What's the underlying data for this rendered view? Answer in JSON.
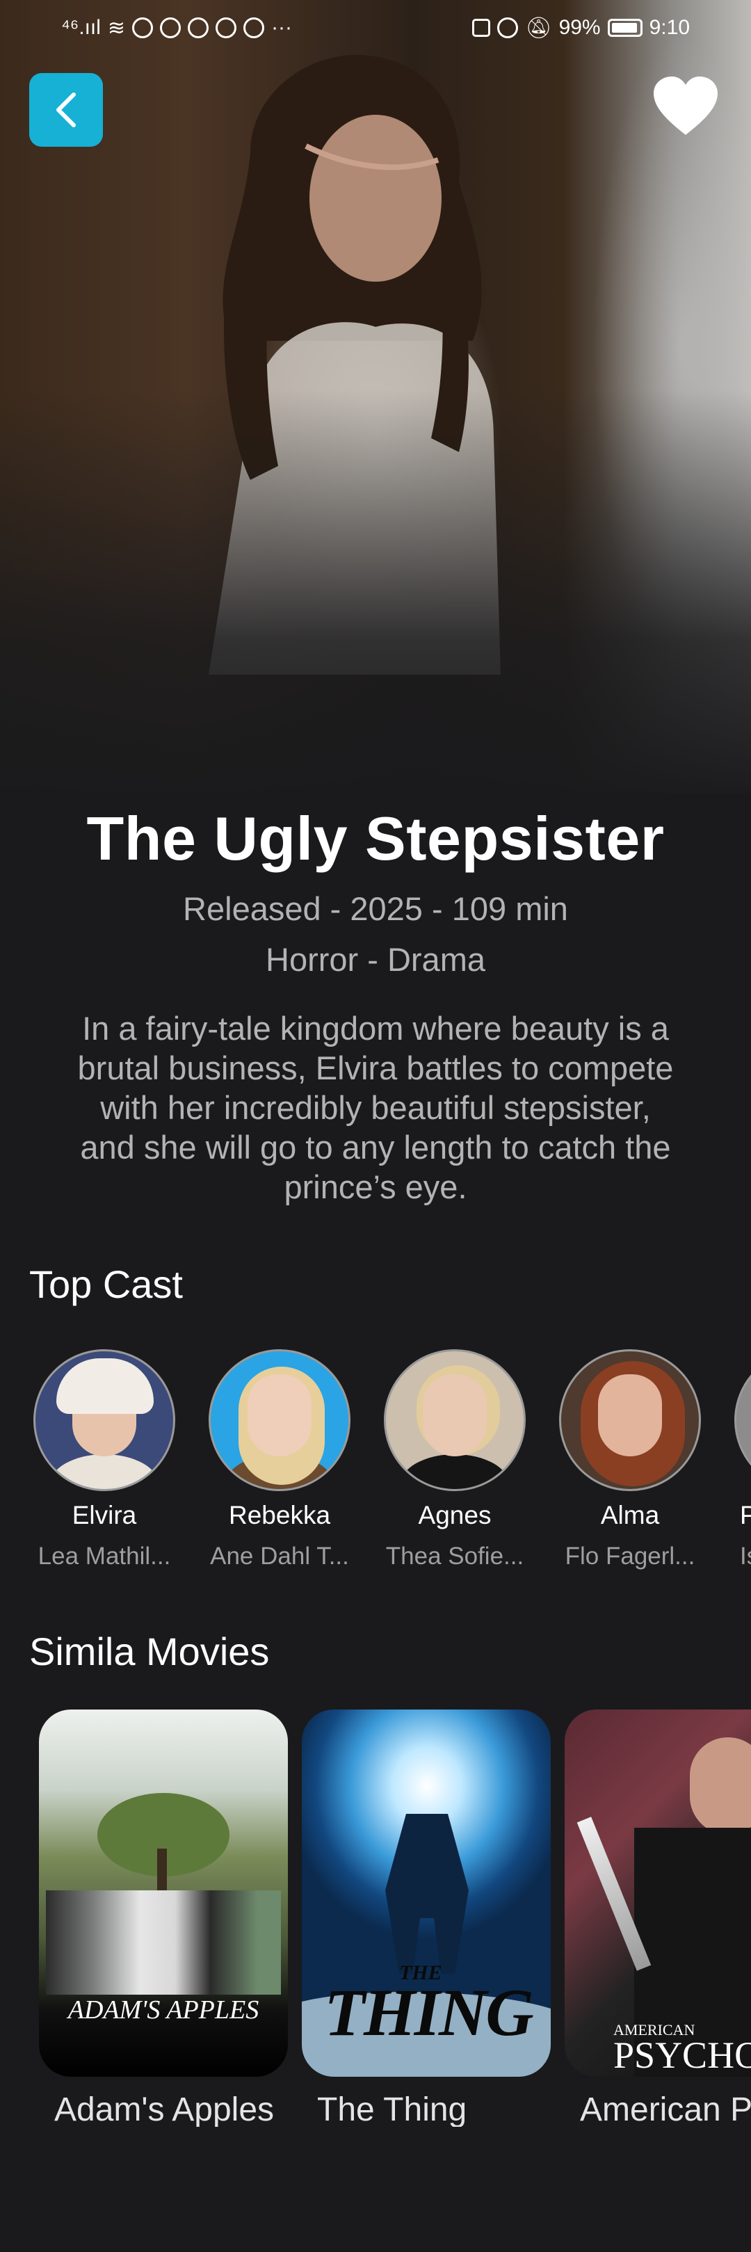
{
  "status_bar": {
    "network": "⁴⁶.ııl",
    "more": "···",
    "battery": "99%",
    "time": "9:10"
  },
  "movie": {
    "title": "The Ugly Stepsister",
    "released_line": "Released - 2025 - 109 min",
    "genres_line": "Horror - Drama",
    "overview_lines": [
      "In a fairy-tale kingdom where beauty is a",
      "brutal business, Elvira battles to compete",
      "with her incredibly beautiful stepsister,",
      "and she will go to any length to catch the",
      "prince’s eye."
    ]
  },
  "sections": {
    "cast_title": "Top Cast",
    "similar_title": "Simila Movies"
  },
  "cast": [
    {
      "character": "Elvira",
      "actor": "Lea Mathil..."
    },
    {
      "character": "Rebekka",
      "actor": "Ane Dahl T..."
    },
    {
      "character": "Agnes",
      "actor": "Thea Sofie..."
    },
    {
      "character": "Alma",
      "actor": "Flo Fagerl..."
    },
    {
      "character": "P",
      "actor": "Is"
    }
  ],
  "similar_movies": [
    {
      "title": "Adam's Apples",
      "poster_text": "ADAM'S APPLES"
    },
    {
      "title": "The Thing",
      "poster_text_small": "THE",
      "poster_text": "THING"
    },
    {
      "title": "American P",
      "poster_text_small": "AMERICAN",
      "poster_text": "PSYCHO"
    }
  ],
  "colors": {
    "background": "#1a1a1c",
    "accent": "#16b1d4",
    "muted_text": "#b3b3b3"
  },
  "icons": {
    "back": "chevron-left-icon",
    "favorite": "heart-icon"
  }
}
